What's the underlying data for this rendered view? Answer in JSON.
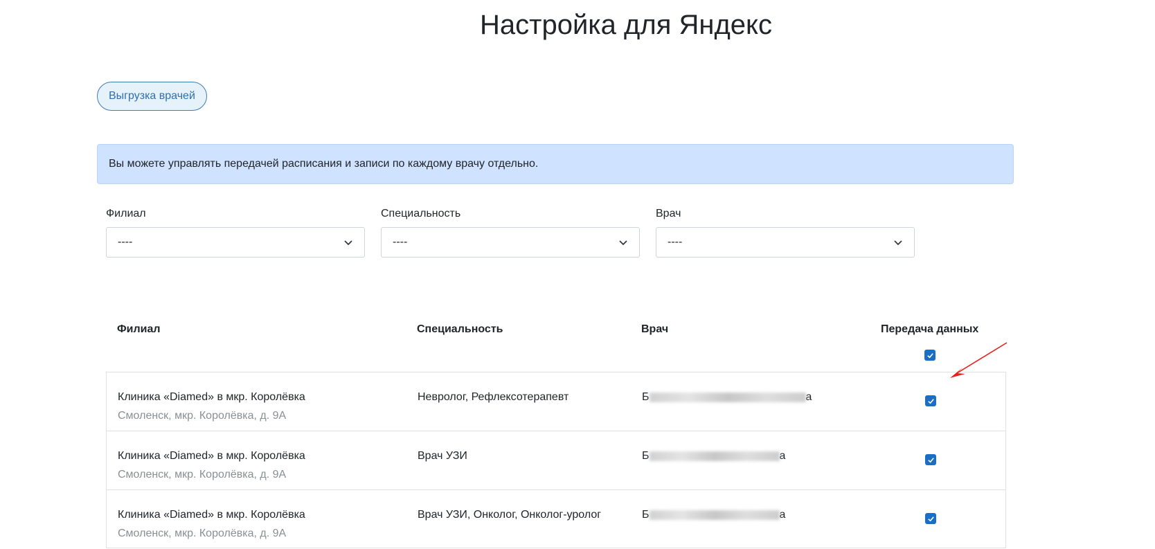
{
  "page": {
    "title": "Настройка для Яндекс"
  },
  "toolbar": {
    "export_label": "Выгрузка врачей"
  },
  "alert": {
    "text": "Вы можете управлять передачей расписания и записи по каждому врачу отдельно."
  },
  "filters": [
    {
      "label": "Филиал",
      "value": "----"
    },
    {
      "label": "Специальность",
      "value": "----"
    },
    {
      "label": "Врач",
      "value": "----"
    }
  ],
  "table": {
    "headers": {
      "branch": "Филиал",
      "specialty": "Специальность",
      "doctor": "Врач",
      "transfer": "Передача данных"
    },
    "select_all_checked": true,
    "rows": [
      {
        "branch": "Клиника «Diamed» в мкр. Королёвка",
        "address": "Смоленск, мкр. Королёвка, д. 9А",
        "specialty": "Невролог, Рефлексотерапевт",
        "doctor_visible_start": "Б",
        "doctor_visible_end": "а",
        "checked": true
      },
      {
        "branch": "Клиника «Diamed» в мкр. Королёвка",
        "address": "Смоленск, мкр. Королёвка, д. 9А",
        "specialty": "Врач УЗИ",
        "doctor_visible_start": "Б",
        "doctor_visible_end": "а",
        "checked": true
      },
      {
        "branch": "Клиника «Diamed» в мкр. Королёвка",
        "address": "Смоленск, мкр. Королёвка, д. 9А",
        "specialty": "Врач УЗИ, Онколог, Онколог-уролог",
        "doctor_visible_start": "Б",
        "doctor_visible_end": "а",
        "checked": true
      }
    ]
  },
  "colors": {
    "accent": "#1a6fc4",
    "alert_bg": "#cfe2ff",
    "annotation": "#e8201a"
  },
  "icons": {
    "select": "chevron-down-icon",
    "checkbox": "check-icon",
    "annotation": "red-arrow-icon"
  }
}
